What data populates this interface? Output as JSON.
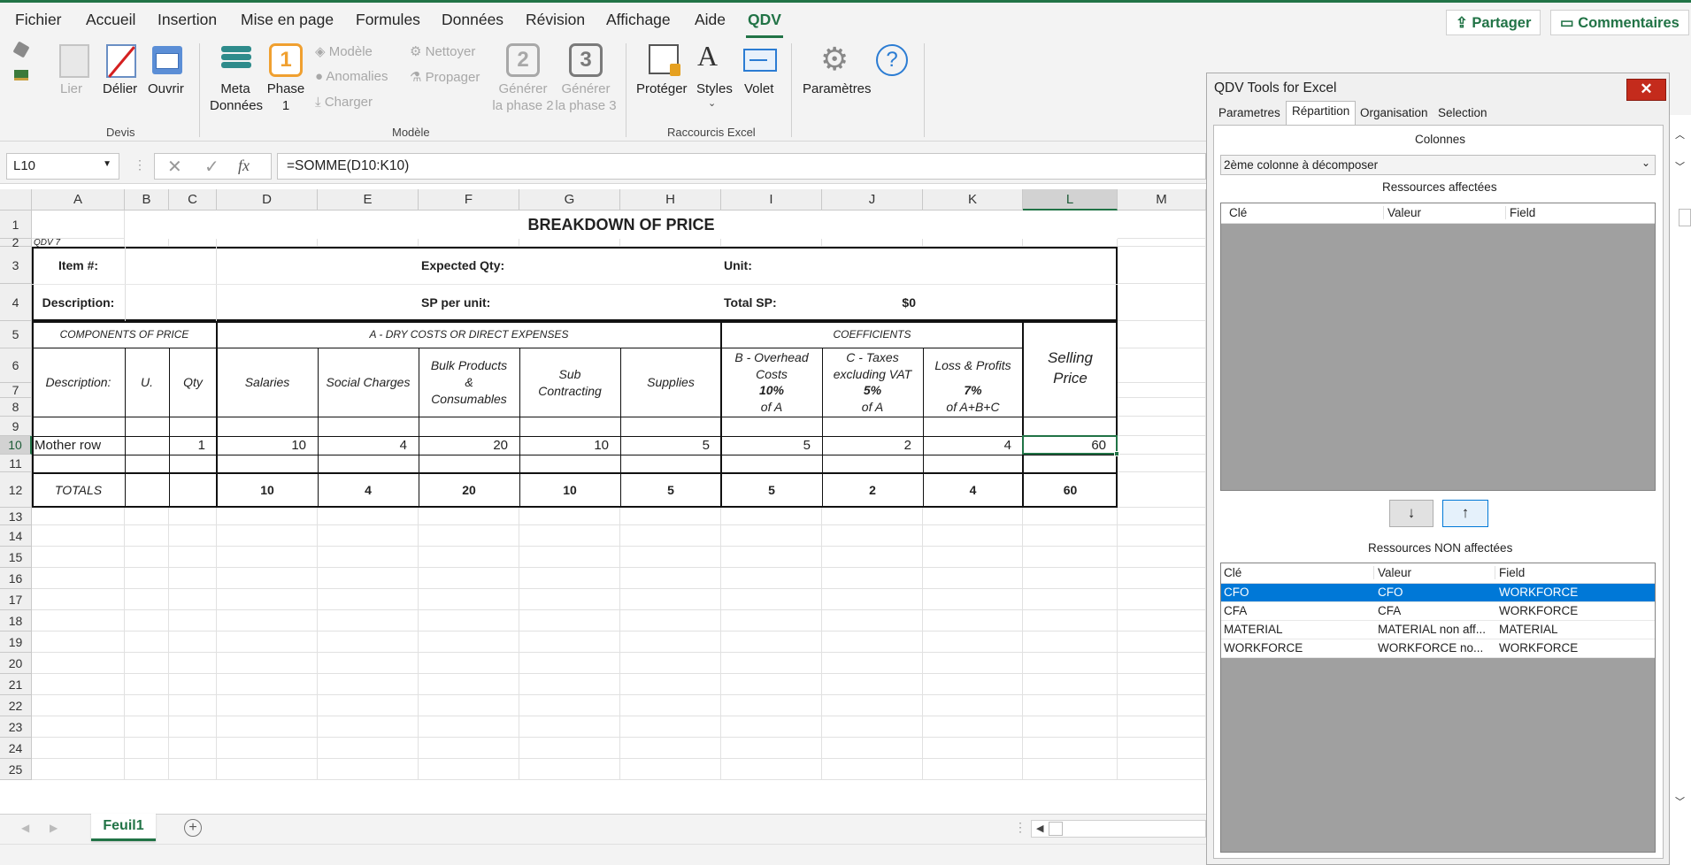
{
  "menu": {
    "items": [
      "Fichier",
      "Accueil",
      "Insertion",
      "Mise en page",
      "Formules",
      "Données",
      "Révision",
      "Affichage",
      "Aide",
      "QDV"
    ],
    "active": "QDV",
    "share": "Partager",
    "comments": "Commentaires"
  },
  "ribbon": {
    "devis": {
      "lier": "Lier",
      "delier": "Délier",
      "ouvrir": "Ouvrir",
      "group": "Devis"
    },
    "modele": {
      "meta": "Meta\nDonnées",
      "phase1_num": "1",
      "phase1": "Phase\n1",
      "modele": "Modèle",
      "anomalies": "Anomalies",
      "charger": "Charger",
      "nettoyer": "Nettoyer",
      "propager": "Propager",
      "phase2_num": "2",
      "phase2": "Générer\nla phase 2",
      "phase3_num": "3",
      "phase3": "Générer\nla phase 3",
      "group": "Modèle"
    },
    "raccourcis": {
      "proteger": "Protéger",
      "styles": "Styles",
      "volet": "Volet",
      "group": "Raccourcis Excel"
    },
    "parametres": "Paramètres"
  },
  "formula_bar": {
    "name_box": "L10",
    "fx": "fx",
    "formula": "=SOMME(D10:K10)"
  },
  "sheet": {
    "columns": [
      "A",
      "B",
      "C",
      "D",
      "E",
      "F",
      "G",
      "H",
      "I",
      "J",
      "K",
      "L",
      "M"
    ],
    "rows": [
      "1",
      "2",
      "3",
      "4",
      "5",
      "6",
      "7",
      "8",
      "9",
      "10",
      "11",
      "12",
      "13",
      "14",
      "15",
      "16",
      "17",
      "18",
      "19",
      "20",
      "21",
      "22",
      "23",
      "24",
      "25"
    ],
    "title": "BREAKDOWN OF PRICE",
    "qdv_tag": "QDV 7",
    "item_label": "Item #:",
    "expected_qty": "Expected Qty:",
    "unit": "Unit:",
    "description_label": "Description:",
    "sp_per_unit": "SP per unit:",
    "total_sp": "Total SP:",
    "total_sp_value": "$0",
    "components": "COMPONENTS OF PRICE",
    "dry_costs": "A - DRY COSTS OR DIRECT EXPENSES",
    "coefficients": "COEFFICIENTS",
    "h_description": "Description:",
    "h_u": "U.",
    "h_qty": "Qty",
    "h_salaries": "Salaries",
    "h_social": "Social Charges",
    "h_bulk": "Bulk Products\n&\nConsumables",
    "h_sub": "Sub\nContracting",
    "h_supplies": "Supplies",
    "h_overhead": "B - Overhead\nCosts",
    "h_overhead_pct": "10%",
    "h_overhead_of": "of A",
    "h_taxes": "C - Taxes\nexcluding VAT",
    "h_taxes_pct": "5%",
    "h_taxes_of": "of A",
    "h_loss": "Loss & Profits",
    "h_loss_pct": "7%",
    "h_loss_of": "of A+B+C",
    "h_selling": "Selling\nPrice",
    "row10": {
      "desc": "Mother row",
      "qty": "1",
      "salaries": "10",
      "social": "4",
      "bulk": "20",
      "sub": "10",
      "supplies": "5",
      "overhead": "5",
      "taxes": "2",
      "loss": "4",
      "selling": "60"
    },
    "totals": {
      "label": "TOTALS",
      "salaries": "10",
      "social": "4",
      "bulk": "20",
      "sub": "10",
      "supplies": "5",
      "overhead": "5",
      "taxes": "2",
      "loss": "4",
      "selling": "60"
    },
    "tab": "Feuil1"
  },
  "panel": {
    "title": "QDV Tools for Excel",
    "tabs": [
      "Parametres",
      "Répartition",
      "Organisation",
      "Selection"
    ],
    "active_tab": "Répartition",
    "colonnes_label": "Colonnes",
    "colonnes_value": "2ème colonne à décomposer",
    "affectees_label": "Ressources affectées",
    "headers": [
      "Clé",
      "Valeur",
      "Field"
    ],
    "down": "↓",
    "up": "↑",
    "non_affectees_label": "Ressources NON affectées",
    "non_affectees": [
      {
        "cle": "CFO",
        "valeur": "CFO",
        "field": "WORKFORCE"
      },
      {
        "cle": "CFA",
        "valeur": "CFA",
        "field": "WORKFORCE"
      },
      {
        "cle": "MATERIAL",
        "valeur": "MATERIAL non aff...",
        "field": "MATERIAL"
      },
      {
        "cle": "WORKFORCE",
        "valeur": "WORKFORCE no...",
        "field": "WORKFORCE"
      }
    ]
  },
  "colors": {
    "excel_green": "#217346",
    "selection_blue": "#0078d7",
    "close_red": "#c42b1c"
  }
}
